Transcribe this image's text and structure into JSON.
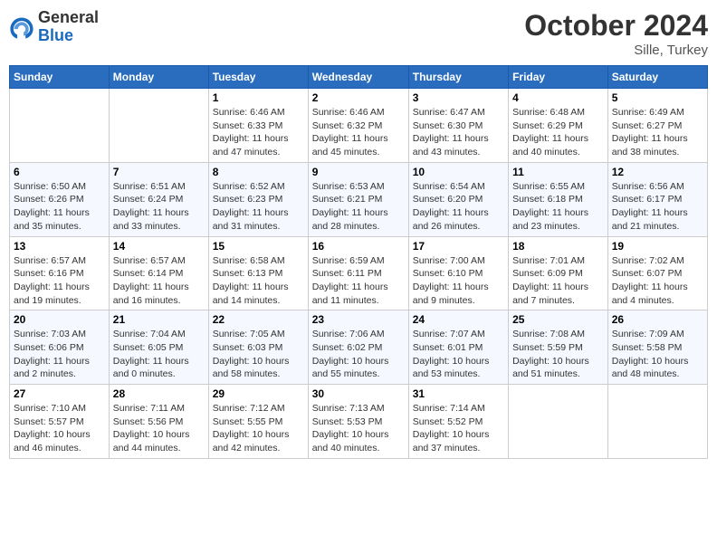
{
  "header": {
    "logo_general": "General",
    "logo_blue": "Blue",
    "month_title": "October 2024",
    "location": "Sille, Turkey"
  },
  "days_of_week": [
    "Sunday",
    "Monday",
    "Tuesday",
    "Wednesday",
    "Thursday",
    "Friday",
    "Saturday"
  ],
  "weeks": [
    [
      {
        "day": null,
        "info": null
      },
      {
        "day": null,
        "info": null
      },
      {
        "day": "1",
        "info": "Sunrise: 6:46 AM\nSunset: 6:33 PM\nDaylight: 11 hours and 47 minutes."
      },
      {
        "day": "2",
        "info": "Sunrise: 6:46 AM\nSunset: 6:32 PM\nDaylight: 11 hours and 45 minutes."
      },
      {
        "day": "3",
        "info": "Sunrise: 6:47 AM\nSunset: 6:30 PM\nDaylight: 11 hours and 43 minutes."
      },
      {
        "day": "4",
        "info": "Sunrise: 6:48 AM\nSunset: 6:29 PM\nDaylight: 11 hours and 40 minutes."
      },
      {
        "day": "5",
        "info": "Sunrise: 6:49 AM\nSunset: 6:27 PM\nDaylight: 11 hours and 38 minutes."
      }
    ],
    [
      {
        "day": "6",
        "info": "Sunrise: 6:50 AM\nSunset: 6:26 PM\nDaylight: 11 hours and 35 minutes."
      },
      {
        "day": "7",
        "info": "Sunrise: 6:51 AM\nSunset: 6:24 PM\nDaylight: 11 hours and 33 minutes."
      },
      {
        "day": "8",
        "info": "Sunrise: 6:52 AM\nSunset: 6:23 PM\nDaylight: 11 hours and 31 minutes."
      },
      {
        "day": "9",
        "info": "Sunrise: 6:53 AM\nSunset: 6:21 PM\nDaylight: 11 hours and 28 minutes."
      },
      {
        "day": "10",
        "info": "Sunrise: 6:54 AM\nSunset: 6:20 PM\nDaylight: 11 hours and 26 minutes."
      },
      {
        "day": "11",
        "info": "Sunrise: 6:55 AM\nSunset: 6:18 PM\nDaylight: 11 hours and 23 minutes."
      },
      {
        "day": "12",
        "info": "Sunrise: 6:56 AM\nSunset: 6:17 PM\nDaylight: 11 hours and 21 minutes."
      }
    ],
    [
      {
        "day": "13",
        "info": "Sunrise: 6:57 AM\nSunset: 6:16 PM\nDaylight: 11 hours and 19 minutes."
      },
      {
        "day": "14",
        "info": "Sunrise: 6:57 AM\nSunset: 6:14 PM\nDaylight: 11 hours and 16 minutes."
      },
      {
        "day": "15",
        "info": "Sunrise: 6:58 AM\nSunset: 6:13 PM\nDaylight: 11 hours and 14 minutes."
      },
      {
        "day": "16",
        "info": "Sunrise: 6:59 AM\nSunset: 6:11 PM\nDaylight: 11 hours and 11 minutes."
      },
      {
        "day": "17",
        "info": "Sunrise: 7:00 AM\nSunset: 6:10 PM\nDaylight: 11 hours and 9 minutes."
      },
      {
        "day": "18",
        "info": "Sunrise: 7:01 AM\nSunset: 6:09 PM\nDaylight: 11 hours and 7 minutes."
      },
      {
        "day": "19",
        "info": "Sunrise: 7:02 AM\nSunset: 6:07 PM\nDaylight: 11 hours and 4 minutes."
      }
    ],
    [
      {
        "day": "20",
        "info": "Sunrise: 7:03 AM\nSunset: 6:06 PM\nDaylight: 11 hours and 2 minutes."
      },
      {
        "day": "21",
        "info": "Sunrise: 7:04 AM\nSunset: 6:05 PM\nDaylight: 11 hours and 0 minutes."
      },
      {
        "day": "22",
        "info": "Sunrise: 7:05 AM\nSunset: 6:03 PM\nDaylight: 10 hours and 58 minutes."
      },
      {
        "day": "23",
        "info": "Sunrise: 7:06 AM\nSunset: 6:02 PM\nDaylight: 10 hours and 55 minutes."
      },
      {
        "day": "24",
        "info": "Sunrise: 7:07 AM\nSunset: 6:01 PM\nDaylight: 10 hours and 53 minutes."
      },
      {
        "day": "25",
        "info": "Sunrise: 7:08 AM\nSunset: 5:59 PM\nDaylight: 10 hours and 51 minutes."
      },
      {
        "day": "26",
        "info": "Sunrise: 7:09 AM\nSunset: 5:58 PM\nDaylight: 10 hours and 48 minutes."
      }
    ],
    [
      {
        "day": "27",
        "info": "Sunrise: 7:10 AM\nSunset: 5:57 PM\nDaylight: 10 hours and 46 minutes."
      },
      {
        "day": "28",
        "info": "Sunrise: 7:11 AM\nSunset: 5:56 PM\nDaylight: 10 hours and 44 minutes."
      },
      {
        "day": "29",
        "info": "Sunrise: 7:12 AM\nSunset: 5:55 PM\nDaylight: 10 hours and 42 minutes."
      },
      {
        "day": "30",
        "info": "Sunrise: 7:13 AM\nSunset: 5:53 PM\nDaylight: 10 hours and 40 minutes."
      },
      {
        "day": "31",
        "info": "Sunrise: 7:14 AM\nSunset: 5:52 PM\nDaylight: 10 hours and 37 minutes."
      },
      {
        "day": null,
        "info": null
      },
      {
        "day": null,
        "info": null
      }
    ]
  ]
}
